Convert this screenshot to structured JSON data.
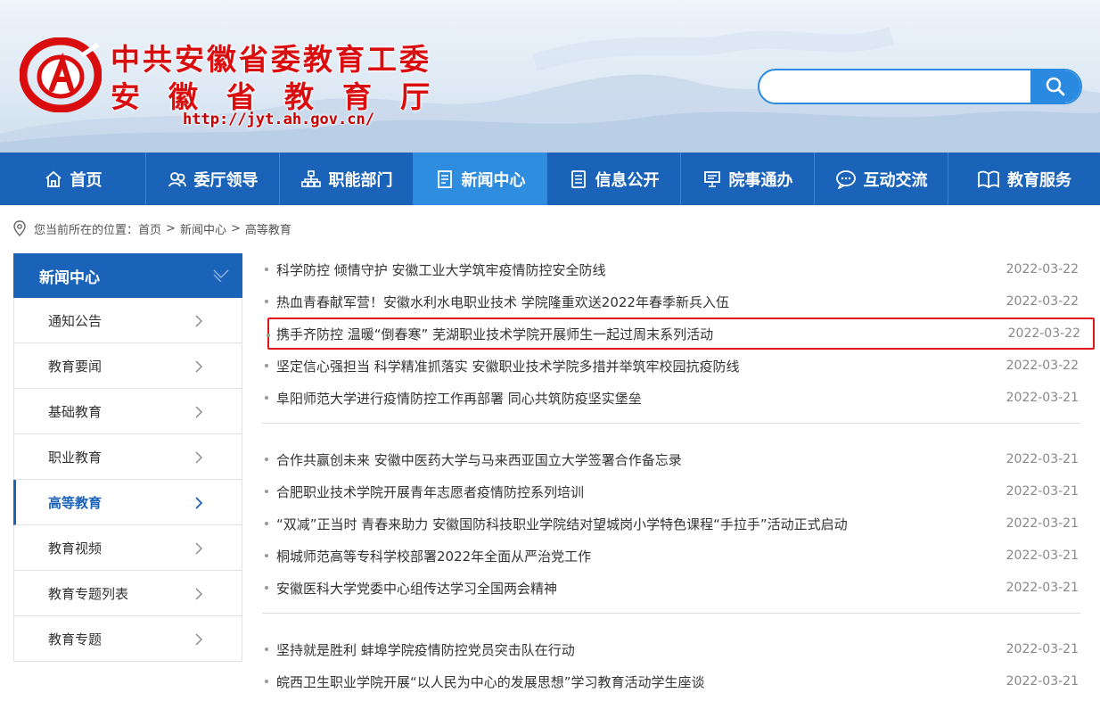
{
  "header": {
    "org_name": "中共安徽省委教育工委",
    "dept_name": "安徽省教育厅",
    "url": "http://jyt.ah.gov.cn/",
    "search_placeholder": ""
  },
  "nav": [
    {
      "label": "首页",
      "icon": "home-icon",
      "active": false
    },
    {
      "label": "委厅领导",
      "icon": "people-icon",
      "active": false
    },
    {
      "label": "职能部门",
      "icon": "org-chart-icon",
      "active": false
    },
    {
      "label": "新闻中心",
      "icon": "document-icon",
      "active": true
    },
    {
      "label": "信息公开",
      "icon": "list-icon",
      "active": false
    },
    {
      "label": "院事通办",
      "icon": "monitor-icon",
      "active": false
    },
    {
      "label": "互动交流",
      "icon": "chat-icon",
      "active": false
    },
    {
      "label": "教育服务",
      "icon": "book-icon",
      "active": false
    }
  ],
  "breadcrumb": {
    "prefix": "您当前所在的位置：",
    "items": [
      "首页",
      "新闻中心",
      "高等教育"
    ]
  },
  "sidebar": {
    "title": "新闻中心",
    "items": [
      {
        "label": "通知公告"
      },
      {
        "label": "教育要闻"
      },
      {
        "label": "基础教育"
      },
      {
        "label": "职业教育"
      },
      {
        "label": "高等教育",
        "active": true
      },
      {
        "label": "教育视频"
      },
      {
        "label": "教育专题列表"
      },
      {
        "label": "教育专题"
      }
    ]
  },
  "news_groups": [
    [
      {
        "title": "科学防控 倾情守护 安徽工业大学筑牢疫情防控安全防线",
        "date": "2022-03-22"
      },
      {
        "title": "热血青春献军营！安徽水利水电职业技术 学院隆重欢送2022年春季新兵入伍",
        "date": "2022-03-22"
      },
      {
        "title": "携手齐防控 温暖“倒春寒” 芜湖职业技术学院开展师生一起过周末系列活动",
        "date": "2022-03-22",
        "highlighted": true
      },
      {
        "title": "坚定信心强担当 科学精准抓落实 安徽职业技术学院多措并举筑牢校园抗疫防线",
        "date": "2022-03-22"
      },
      {
        "title": "阜阳师范大学进行疫情防控工作再部署 同心共筑防疫坚实堡垒",
        "date": "2022-03-21"
      }
    ],
    [
      {
        "title": "合作共赢创未来 安徽中医药大学与马来西亚国立大学签署合作备忘录",
        "date": "2022-03-21"
      },
      {
        "title": "合肥职业技术学院开展青年志愿者疫情防控系列培训",
        "date": "2022-03-21"
      },
      {
        "title": "“双减”正当时 青春来助力 安徽国防科技职业学院结对望城岗小学特色课程“手拉手”活动正式启动",
        "date": "2022-03-21"
      },
      {
        "title": "桐城师范高等专科学校部署2022年全面从严治党工作",
        "date": "2022-03-21"
      },
      {
        "title": "安徽医科大学党委中心组传达学习全国两会精神",
        "date": "2022-03-21"
      }
    ],
    [
      {
        "title": "坚持就是胜利 蚌埠学院疫情防控党员突击队在行动",
        "date": "2022-03-21"
      },
      {
        "title": "皖西卫生职业学院开展“以人民为中心的发展思想”学习教育活动学生座谈",
        "date": "2022-03-21"
      }
    ]
  ],
  "colors": {
    "brand_blue": "#1a63b9",
    "active_nav": "#2f8de0",
    "title_red": "#d90d0d",
    "highlight_border": "#e0151a"
  }
}
